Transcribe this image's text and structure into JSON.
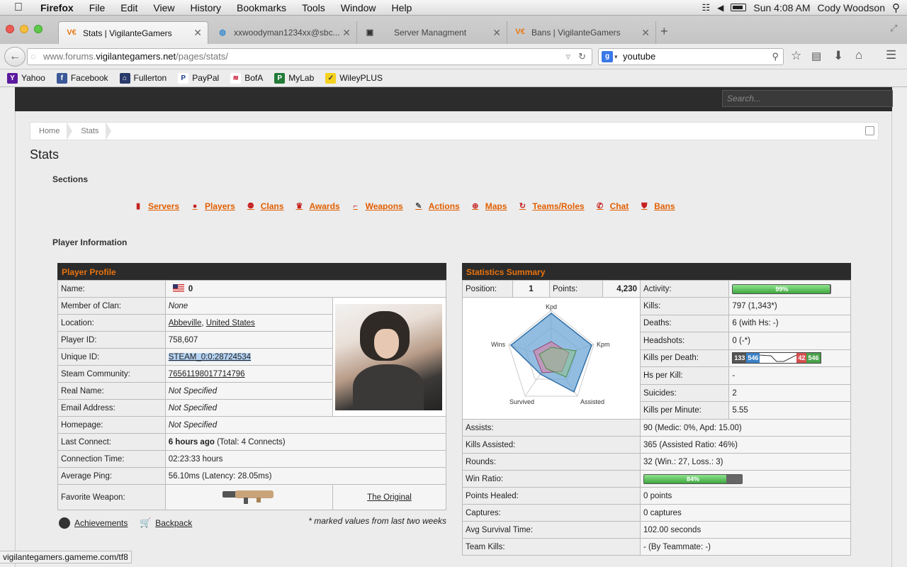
{
  "menubar": {
    "app": "Firefox",
    "items": [
      "File",
      "Edit",
      "View",
      "History",
      "Bookmarks",
      "Tools",
      "Window",
      "Help"
    ],
    "clock": "Sun 4:08 AM",
    "user": "Cody Woodson"
  },
  "tabs": [
    {
      "label": "Stats | VigilanteGamers",
      "active": true
    },
    {
      "label": "xxwoodyman1234xx@sbc...",
      "active": false
    },
    {
      "label": "Server Managment",
      "active": false
    },
    {
      "label": "Bans | VigilanteGamers",
      "active": false
    }
  ],
  "nav": {
    "url_prefix": "www.forums.",
    "url_domain": "vigilantegamers.net",
    "url_path": "/pages/stats/",
    "search_value": "youtube"
  },
  "bookmarks": [
    "Yahoo",
    "Facebook",
    "Fullerton",
    "PayPal",
    "BofA",
    "MyLab",
    "WileyPLUS"
  ],
  "site": {
    "search_placeholder": "Search...",
    "breadcrumb": [
      "Home",
      "Stats"
    ],
    "title": "Stats",
    "sections_heading": "Sections",
    "sections": [
      "Servers",
      "Players",
      "Clans",
      "Awards",
      "Weapons",
      "Actions",
      "Maps",
      "Teams/Roles",
      "Chat",
      "Bans"
    ],
    "player_info_heading": "Player Information"
  },
  "profile": {
    "header": "Player Profile",
    "name_label": "Name:",
    "name_value": "0",
    "clan_label": "Member of Clan:",
    "clan_value": "None",
    "location_label": "Location:",
    "location_city": "Abbeville",
    "location_country": "United States",
    "playerid_label": "Player ID:",
    "playerid_value": "758,607",
    "uniqueid_label": "Unique ID:",
    "uniqueid_value": "STEAM_0:0:28724534",
    "steam_label": "Steam Community:",
    "steam_value": "76561198017714796",
    "realname_label": "Real Name:",
    "realname_value": "Not Specified",
    "email_label": "Email Address:",
    "email_value": "Not Specified",
    "homepage_label": "Homepage:",
    "homepage_value": "Not Specified",
    "lastconnect_label": "Last Connect:",
    "lastconnect_bold": "6 hours ago",
    "lastconnect_rest": "(Total: 4 Connects)",
    "conntime_label": "Connection Time:",
    "conntime_value": "02:23:33 hours",
    "ping_label": "Average Ping:",
    "ping_value": "56.10ms (Latency: 28.05ms)",
    "weapon_label": "Favorite Weapon:",
    "weapon_name": "The Original",
    "achievements": "Achievements",
    "backpack": "Backpack",
    "note": "* marked values from last two weeks"
  },
  "summary": {
    "header": "Statistics Summary",
    "position_label": "Position:",
    "position_value": "1",
    "points_label": "Points:",
    "points_value": "4,230",
    "activity_label": "Activity:",
    "activity_value": "99%",
    "activity_pct": 99,
    "kills_label": "Kills:",
    "kills_value": "797 (1,343*)",
    "deaths_label": "Deaths:",
    "deaths_value": "6 (with Hs: -)",
    "headshots_label": "Headshots:",
    "headshots_value": "0 (-*)",
    "kpd_label": "Kills per Death:",
    "kpd_a": "133",
    "kpd_b": "546",
    "kpd_c": "42",
    "kpd_d": "546",
    "hpk_label": "Hs per Kill:",
    "hpk_value": "-",
    "suicides_label": "Suicides:",
    "suicides_value": "2",
    "kpm_label": "Kills per Minute:",
    "kpm_value": "5.55",
    "assists_label": "Assists:",
    "assists_value": "90 (Medic: 0%, Apd: 15.00)",
    "killsassisted_label": "Kills Assisted:",
    "killsassisted_value": "365 (Assisted Ratio: 46%)",
    "rounds_label": "Rounds:",
    "rounds_value": "32 (Win.: 27, Loss.: 3)",
    "winratio_label": "Win Ratio:",
    "winratio_value": "84%",
    "winratio_pct": 84,
    "healed_label": "Points Healed:",
    "healed_value": "0 points",
    "captures_label": "Captures:",
    "captures_value": "0 captures",
    "survival_label": "Avg Survival Time:",
    "survival_value": "102.00 seconds",
    "teamkills_label": "Team Kills:",
    "teamkills_value": "- (By Teammate: -)",
    "radar_axes": [
      "Kpd",
      "Kpm",
      "Assisted",
      "Survived",
      "Wins"
    ]
  },
  "status_url": "vigilantegamers.gameme.com/tf8"
}
